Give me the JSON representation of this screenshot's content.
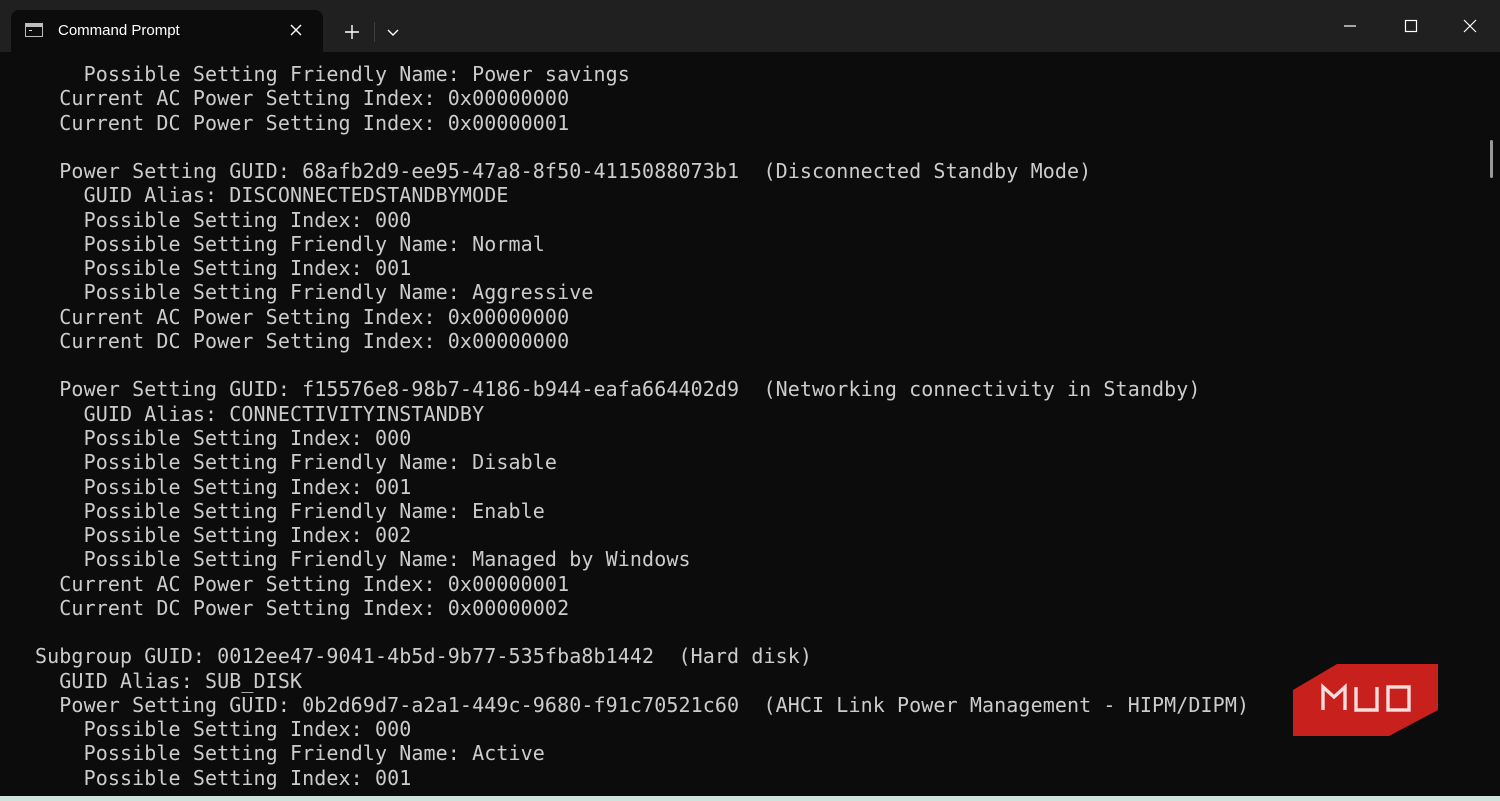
{
  "window": {
    "tab_title": "Command Prompt",
    "controls": {
      "new_tab": "+",
      "minimize": "minimize",
      "maximize": "maximize",
      "close": "close"
    }
  },
  "terminal": {
    "lines": [
      "    Possible Setting Friendly Name: Power savings",
      "  Current AC Power Setting Index: 0x00000000",
      "  Current DC Power Setting Index: 0x00000001",
      "",
      "  Power Setting GUID: 68afb2d9-ee95-47a8-8f50-4115088073b1  (Disconnected Standby Mode)",
      "    GUID Alias: DISCONNECTEDSTANDBYMODE",
      "    Possible Setting Index: 000",
      "    Possible Setting Friendly Name: Normal",
      "    Possible Setting Index: 001",
      "    Possible Setting Friendly Name: Aggressive",
      "  Current AC Power Setting Index: 0x00000000",
      "  Current DC Power Setting Index: 0x00000000",
      "",
      "  Power Setting GUID: f15576e8-98b7-4186-b944-eafa664402d9  (Networking connectivity in Standby)",
      "    GUID Alias: CONNECTIVITYINSTANDBY",
      "    Possible Setting Index: 000",
      "    Possible Setting Friendly Name: Disable",
      "    Possible Setting Index: 001",
      "    Possible Setting Friendly Name: Enable",
      "    Possible Setting Index: 002",
      "    Possible Setting Friendly Name: Managed by Windows",
      "  Current AC Power Setting Index: 0x00000001",
      "  Current DC Power Setting Index: 0x00000002",
      "",
      "Subgroup GUID: 0012ee47-9041-4b5d-9b77-535fba8b1442  (Hard disk)",
      "  GUID Alias: SUB_DISK",
      "  Power Setting GUID: 0b2d69d7-a2a1-449c-9680-f91c70521c60  (AHCI Link Power Management - HIPM/DIPM)",
      "    Possible Setting Index: 000",
      "    Possible Setting Friendly Name: Active",
      "    Possible Setting Index: 001"
    ]
  },
  "watermark": {
    "text": "MUO",
    "color": "#c8201c"
  },
  "colors": {
    "terminal_bg": "#0c0c0c",
    "titlebar_bg": "#202020",
    "text": "#cccccc"
  }
}
